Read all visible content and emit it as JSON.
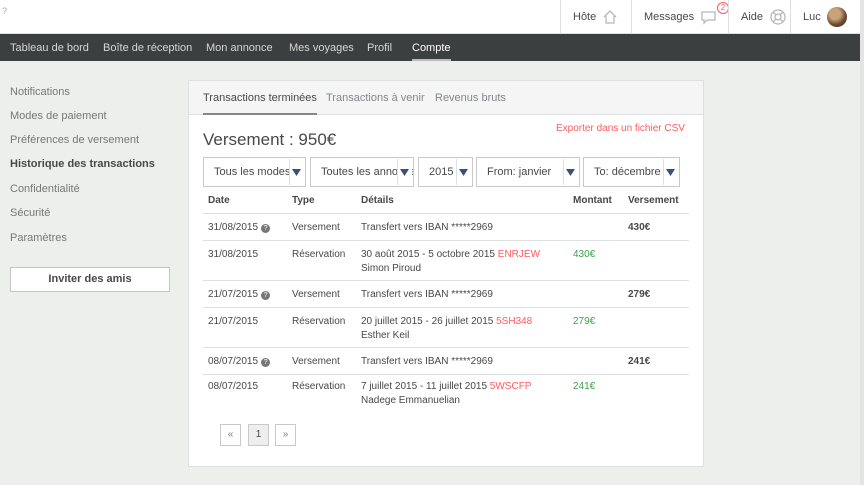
{
  "topbar": {
    "corner_text": "?",
    "host_label": "Hôte",
    "messages_label": "Messages",
    "messages_badge": "2",
    "help_label": "Aide",
    "user_label": "Luc"
  },
  "subnav": {
    "items": [
      {
        "label": "Tableau de bord"
      },
      {
        "label": "Boîte de réception"
      },
      {
        "label": "Mon annonce"
      },
      {
        "label": "Mes voyages"
      },
      {
        "label": "Profil"
      },
      {
        "label": "Compte"
      }
    ],
    "active_index": 5
  },
  "sidebar": {
    "items": [
      {
        "label": "Notifications"
      },
      {
        "label": "Modes de paiement"
      },
      {
        "label": "Préférences de versement"
      },
      {
        "label": "Historique des transactions"
      },
      {
        "label": "Confidentialité"
      },
      {
        "label": "Sécurité"
      },
      {
        "label": "Paramètres"
      }
    ],
    "active_index": 3,
    "invite_label": "Inviter des amis"
  },
  "tabs": [
    {
      "label": "Transactions terminées"
    },
    {
      "label": "Transactions à venir"
    },
    {
      "label": "Revenus bruts"
    }
  ],
  "active_tab": 0,
  "summary": {
    "title": "Versement : 950€",
    "export_label": "Exporter dans un fichier CSV"
  },
  "filters": {
    "mode": "Tous les modes",
    "listing": "Toutes les annonces",
    "year": "2015",
    "from": "From: janvier",
    "to": "To: décembre"
  },
  "table": {
    "headers": {
      "date": "Date",
      "type": "Type",
      "details": "Détails",
      "amount": "Montant",
      "payout": "Versement"
    },
    "rows": [
      {
        "date": "31/08/2015",
        "help": "?",
        "type": "Versement",
        "details": "Transfert vers IBAN *****2969",
        "code": "",
        "guest": "",
        "amount": "",
        "payout": "430€"
      },
      {
        "date": "31/08/2015",
        "help": "",
        "type": "Réservation",
        "details": "30 août 2015 - 5 octobre 2015",
        "code": "ENRJEW",
        "guest": "Simon Piroud",
        "amount": "430€",
        "payout": ""
      },
      {
        "date": "21/07/2015",
        "help": "?",
        "type": "Versement",
        "details": "Transfert vers IBAN *****2969",
        "code": "",
        "guest": "",
        "amount": "",
        "payout": "279€"
      },
      {
        "date": "21/07/2015",
        "help": "",
        "type": "Réservation",
        "details": "20 juillet 2015 - 26 juillet 2015",
        "code": "5SH348",
        "guest": "Esther Keil",
        "amount": "279€",
        "payout": ""
      },
      {
        "date": "08/07/2015",
        "help": "?",
        "type": "Versement",
        "details": "Transfert vers IBAN *****2969",
        "code": "",
        "guest": "",
        "amount": "",
        "payout": "241€"
      },
      {
        "date": "08/07/2015",
        "help": "",
        "type": "Réservation",
        "details": "7 juillet 2015 - 11 juillet 2015",
        "code": "5WSCFP",
        "guest": "Nadege Emmanuelian",
        "amount": "241€",
        "payout": ""
      }
    ]
  },
  "pagination": {
    "prev": "«",
    "current": "1",
    "next": "»"
  },
  "colors": {
    "accent": "#ff5a5f",
    "positive": "#3aa14a",
    "nav_bg": "#3c3f40"
  }
}
